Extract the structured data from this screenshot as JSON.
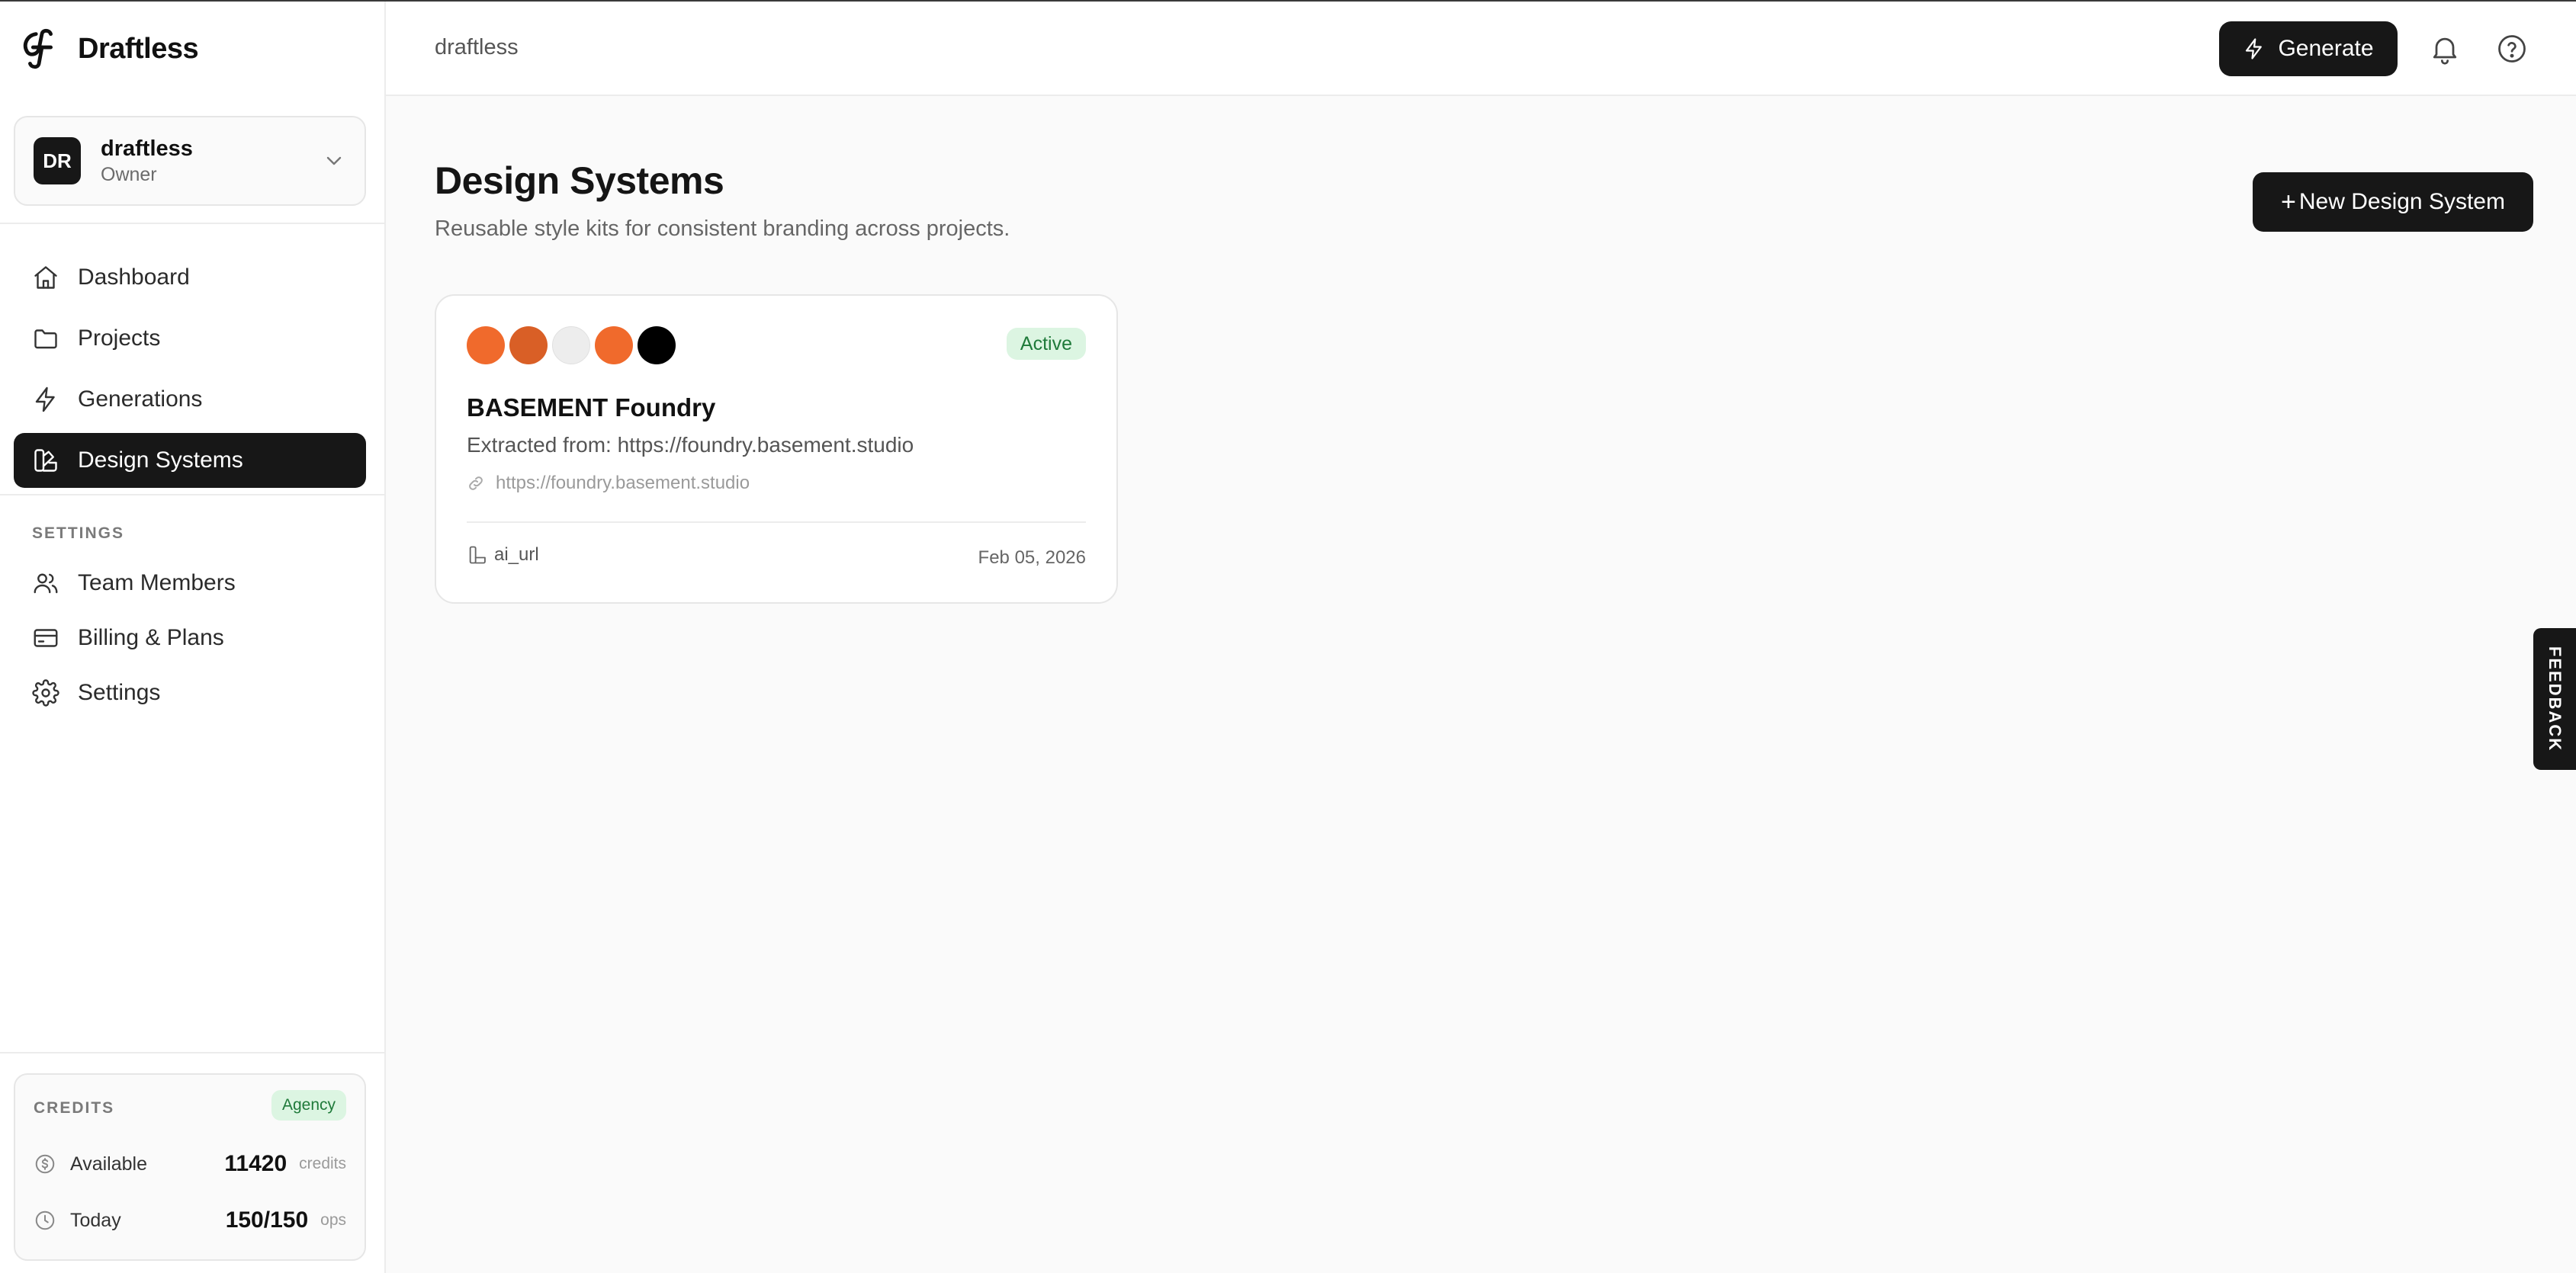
{
  "app": {
    "name": "Draftless"
  },
  "workspace": {
    "initials": "DR",
    "name": "draftless",
    "role": "Owner"
  },
  "nav": [
    {
      "label": "Dashboard",
      "icon": "home-icon"
    },
    {
      "label": "Projects",
      "icon": "folder-icon"
    },
    {
      "label": "Generations",
      "icon": "bolt-icon"
    },
    {
      "label": "Design Systems",
      "icon": "palette-icon",
      "active": true
    }
  ],
  "settings": {
    "section_label": "SETTINGS",
    "items": [
      {
        "label": "Team Members",
        "icon": "users-icon"
      },
      {
        "label": "Billing & Plans",
        "icon": "credit-card-icon"
      },
      {
        "label": "Settings",
        "icon": "gear-icon"
      }
    ]
  },
  "credits": {
    "title": "CREDITS",
    "plan": "Agency",
    "available": {
      "label": "Available",
      "value": "11420",
      "unit": "credits"
    },
    "today": {
      "label": "Today",
      "value": "150/150",
      "unit": "ops"
    }
  },
  "topbar": {
    "breadcrumb": "draftless",
    "generate_label": "Generate"
  },
  "main": {
    "title": "Design Systems",
    "subtitle": "Reusable style kits for consistent branding across projects.",
    "new_button": "New Design System",
    "cards": [
      {
        "swatches": [
          "#f06a2c",
          "#d95f26",
          "#ededed",
          "#f06a2c",
          "#000000"
        ],
        "status": "Active",
        "title": "BASEMENT Foundry",
        "description": "Extracted from: https://foundry.basement.studio",
        "url": "https://foundry.basement.studio",
        "source": "ai_url",
        "date": "Feb 05, 2026"
      }
    ]
  },
  "feedback": {
    "label": "FEEDBACK"
  },
  "colors": {
    "accent": "#171717",
    "success_bg": "#dcf5e2",
    "success_text": "#1f7a3a"
  }
}
